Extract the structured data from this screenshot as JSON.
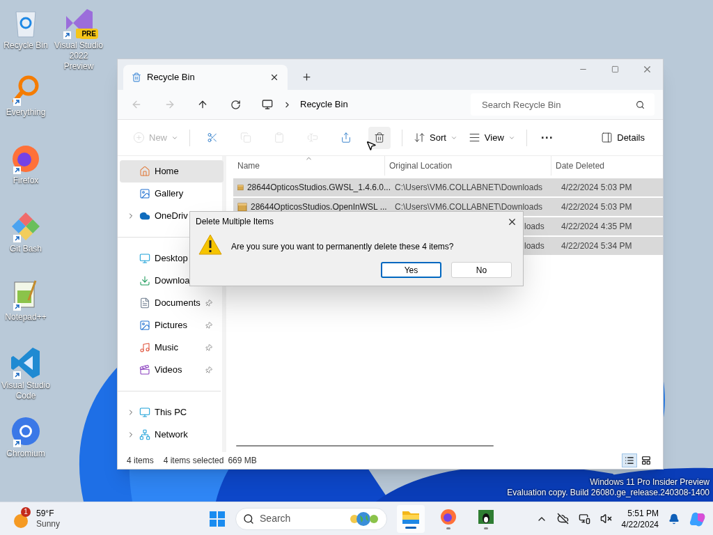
{
  "desktop_icons": [
    {
      "kind": "recycle",
      "label": "Recycle Bin",
      "shortcut": false
    },
    {
      "kind": "vs-preview",
      "label": "Visual Studio 2022 Preview",
      "badge": "PRE",
      "shortcut": true
    },
    {
      "kind": "everything",
      "label": "Everything",
      "shortcut": true
    },
    {
      "kind": "firefox",
      "label": "Firefox",
      "shortcut": true
    },
    {
      "kind": "gitbash",
      "label": "Git Bash",
      "shortcut": true
    },
    {
      "kind": "notepad",
      "label": "Notepad++",
      "shortcut": true
    },
    {
      "kind": "vscode",
      "label": "Visual Studio Code",
      "shortcut": true
    },
    {
      "kind": "chromium",
      "label": "Chromium",
      "shortcut": true
    }
  ],
  "explorer": {
    "tab": {
      "title": "Recycle Bin"
    },
    "address": {
      "crumbs": [
        "Recycle Bin"
      ]
    },
    "search": {
      "placeholder": "Search Recycle Bin"
    },
    "commands": [
      {
        "kind": "new",
        "label": "New",
        "disabled": true
      },
      {
        "kind": "separator"
      },
      {
        "kind": "cut",
        "disabled": false
      },
      {
        "kind": "copy",
        "disabled": true
      },
      {
        "kind": "paste",
        "disabled": true
      },
      {
        "kind": "rename",
        "disabled": true
      },
      {
        "kind": "share",
        "disabled": false
      },
      {
        "kind": "delete",
        "disabled": false,
        "hovered": true
      },
      {
        "kind": "separator"
      },
      {
        "kind": "sort",
        "label": "Sort",
        "disabled": false
      },
      {
        "kind": "view",
        "label": "View",
        "disabled": false
      },
      {
        "kind": "separator"
      },
      {
        "kind": "more",
        "label": "···",
        "disabled": false
      },
      {
        "kind": "details",
        "label": "Details",
        "disabled": false
      }
    ],
    "sidebar": {
      "groups": [
        [
          {
            "kind": "home",
            "label": "Home",
            "selected": true,
            "expandable": false
          },
          {
            "kind": "gallery",
            "label": "Gallery",
            "selected": false,
            "expandable": false
          },
          {
            "kind": "onedrive",
            "label": "OneDriv",
            "selected": false,
            "expandable": true
          }
        ],
        [
          {
            "kind": "desktop",
            "label": "Desktop",
            "selected": false,
            "expandable": false
          },
          {
            "kind": "downloads",
            "label": "Downloa",
            "selected": false,
            "expandable": false
          },
          {
            "kind": "documents",
            "label": "Documents",
            "selected": false,
            "expandable": false,
            "pinned": true
          },
          {
            "kind": "pictures",
            "label": "Pictures",
            "selected": false,
            "expandable": false,
            "pinned": true
          },
          {
            "kind": "music",
            "label": "Music",
            "selected": false,
            "expandable": false,
            "pinned": true
          },
          {
            "kind": "videos",
            "label": "Videos",
            "selected": false,
            "expandable": false,
            "pinned": true
          }
        ],
        [
          {
            "kind": "thispc",
            "label": "This PC",
            "selected": false,
            "expandable": true
          },
          {
            "kind": "network",
            "label": "Network",
            "selected": false,
            "expandable": true
          }
        ]
      ]
    },
    "table": {
      "columns": [
        {
          "label": "Name",
          "sorted": true
        },
        {
          "label": "Original Location",
          "sorted": false
        },
        {
          "label": "Date Deleted",
          "sorted": false
        }
      ],
      "rows": [
        {
          "name": "28644OpticosStudios.GWSL_1.4.6.0...",
          "location": "C:\\Users\\VM6.COLLABNET\\Downloads",
          "date": "4/22/2024 5:03 PM",
          "selected": true,
          "partial": false
        },
        {
          "name": "28644OpticosStudios.OpenInWSL ...",
          "location": "C:\\Users\\VM6.COLLABNET\\Downloads",
          "date": "4/22/2024 5:03 PM",
          "selected": true,
          "partial": false
        },
        {
          "location": "loads",
          "date": "4/22/2024 4:35 PM",
          "selected": true,
          "partial": true
        },
        {
          "location": "loads",
          "date": "4/22/2024 5:34 PM",
          "selected": true,
          "partial": true
        }
      ]
    },
    "status_bar": {
      "count": "4 items",
      "selection": "4 items selected",
      "size": "669 MB",
      "views": [
        {
          "kind": "details",
          "selected": true
        },
        {
          "kind": "tiles",
          "selected": false
        }
      ]
    }
  },
  "dialog": {
    "title": "Delete Multiple Items",
    "message": "Are you sure you want to permanently delete these 4 items?",
    "buttons": [
      {
        "label": "Yes",
        "default": true
      },
      {
        "label": "No",
        "default": false
      }
    ]
  },
  "desktop_notice": [
    "Windows 11 Pro Insider Preview",
    "Evaluation copy. Build 26080.ge_release.240308-1400"
  ],
  "taskbar": {
    "weather": {
      "badge": "1",
      "temperature": "59°F",
      "condition": "Sunny"
    },
    "search": {
      "label": "Search"
    },
    "apps": [
      {
        "kind": "explorer",
        "active": true
      },
      {
        "kind": "firefox",
        "active": false
      },
      {
        "kind": "linux",
        "active": false
      }
    ],
    "clock": {
      "time": "5:51 PM",
      "date": "4/22/2024"
    }
  }
}
